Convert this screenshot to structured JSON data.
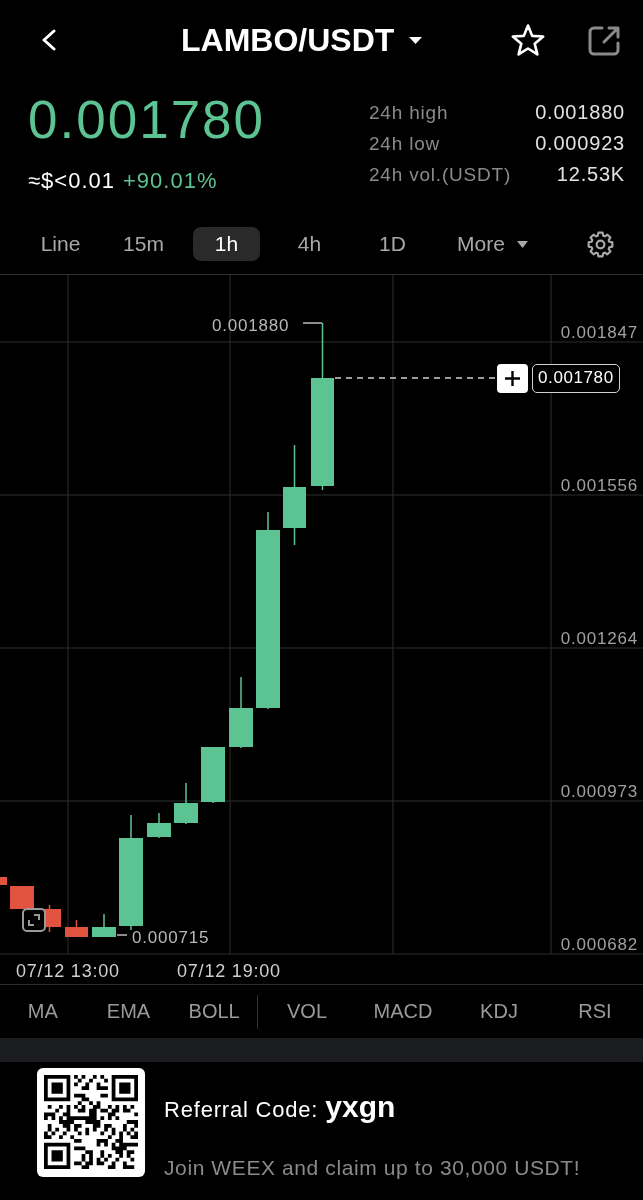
{
  "header": {
    "title": "LAMBO/USDT",
    "favorite": false
  },
  "ticker": {
    "last_price": "0.001780",
    "usd_value": "≈$<0.01",
    "change": "+90.01%",
    "stats": [
      {
        "label": "24h high",
        "value": "0.001880"
      },
      {
        "label": "24h low",
        "value": "0.000923"
      },
      {
        "label": "24h vol.(USDT)",
        "value": "12.53K"
      }
    ]
  },
  "intervals": [
    {
      "label": "Line",
      "selected": false
    },
    {
      "label": "15m",
      "selected": false
    },
    {
      "label": "1h",
      "selected": true
    },
    {
      "label": "4h",
      "selected": false
    },
    {
      "label": "1D",
      "selected": false
    }
  ],
  "more_menu": {
    "label": "More"
  },
  "chart": {
    "price_axis": [
      "0.001847",
      "0.001556",
      "0.001264",
      "0.000973",
      "0.000682"
    ],
    "time_axis": [
      "07/12 13:00",
      "07/12 19:00"
    ],
    "high_label": "0.001880",
    "low_label": "0.000715",
    "last_price_tag": "0.001780"
  },
  "indicators": {
    "main": [
      "MA",
      "EMA",
      "BOLL"
    ],
    "sub": [
      "VOL",
      "MACD",
      "KDJ",
      "RSI"
    ]
  },
  "referral": {
    "label": "Referral Code:",
    "code": "yxgn",
    "message": "Join WEEX and claim up to 30,000 USDT!"
  }
}
